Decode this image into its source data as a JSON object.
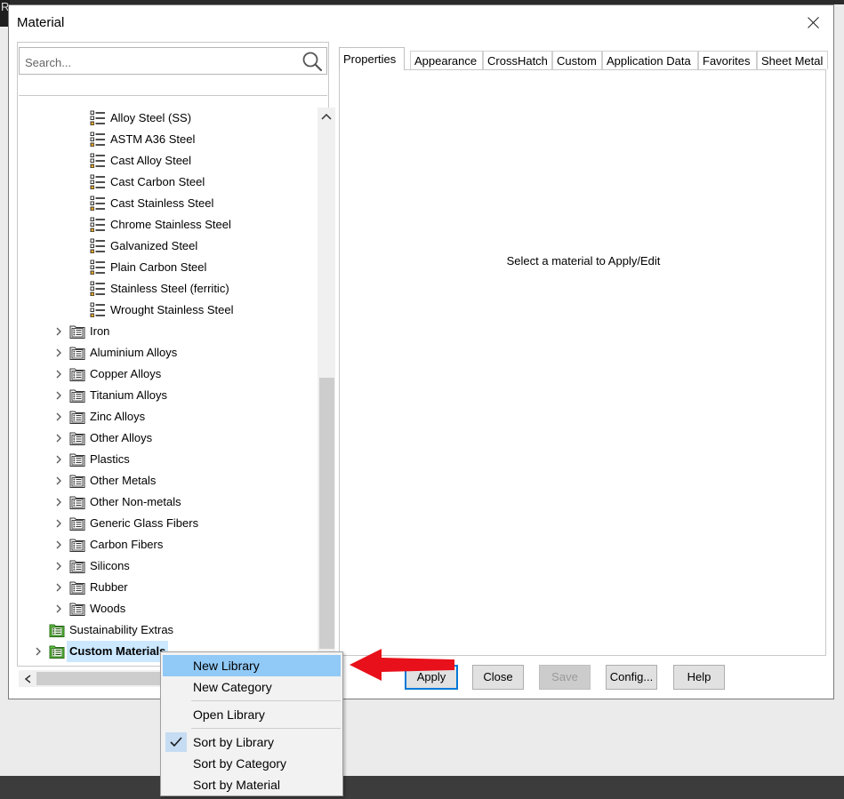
{
  "window": {
    "title": "Material",
    "partial_left_text": "R"
  },
  "search": {
    "placeholder": "Search..."
  },
  "tree": {
    "materials": [
      "Alloy Steel (SS)",
      "ASTM A36 Steel",
      "Cast Alloy Steel",
      "Cast Carbon Steel",
      "Cast Stainless Steel",
      "Chrome Stainless Steel",
      "Galvanized Steel",
      "Plain Carbon Steel",
      "Stainless Steel (ferritic)",
      "Wrought Stainless Steel"
    ],
    "categories": [
      "Iron",
      "Aluminium Alloys",
      "Copper Alloys",
      "Titanium Alloys",
      "Zinc Alloys",
      "Other Alloys",
      "Plastics",
      "Other Metals",
      "Other Non-metals",
      "Generic Glass Fibers",
      "Carbon Fibers",
      "Silicons",
      "Rubber",
      "Woods"
    ],
    "libraries": [
      {
        "label": "Sustainability Extras",
        "selected": false,
        "expandable": false
      },
      {
        "label": "Custom Materials",
        "selected": true,
        "expandable": true
      }
    ]
  },
  "tabs": [
    "Properties",
    "Appearance",
    "CrossHatch",
    "Custom",
    "Application Data",
    "Favorites",
    "Sheet Metal"
  ],
  "active_tab": "Properties",
  "content": {
    "message": "Select a material to Apply/Edit"
  },
  "buttons": {
    "apply": "Apply",
    "close": "Close",
    "save": "Save",
    "config": "Config...",
    "help": "Help"
  },
  "context_menu": {
    "items": [
      {
        "label": "New Library",
        "highlighted": true,
        "checked": false
      },
      {
        "label": "New Category",
        "highlighted": false,
        "checked": false
      },
      {
        "label": "Open Library",
        "highlighted": false,
        "checked": false
      },
      {
        "label": "Sort by Library",
        "highlighted": false,
        "checked": true
      },
      {
        "label": "Sort by Category",
        "highlighted": false,
        "checked": false
      },
      {
        "label": "Sort by Material",
        "highlighted": false,
        "checked": false
      }
    ]
  },
  "colors": {
    "highlight": "#91c9f7",
    "selection": "#cce8ff",
    "arrow": "#e8101a",
    "library_icon": "#5ec83c",
    "primary_border": "#0078d7"
  },
  "icons": {
    "material": "material-list-icon",
    "category": "folder-list-icon",
    "library": "library-icon",
    "search": "search-icon",
    "expand": "chevron-right-icon",
    "check": "checkmark-icon"
  }
}
